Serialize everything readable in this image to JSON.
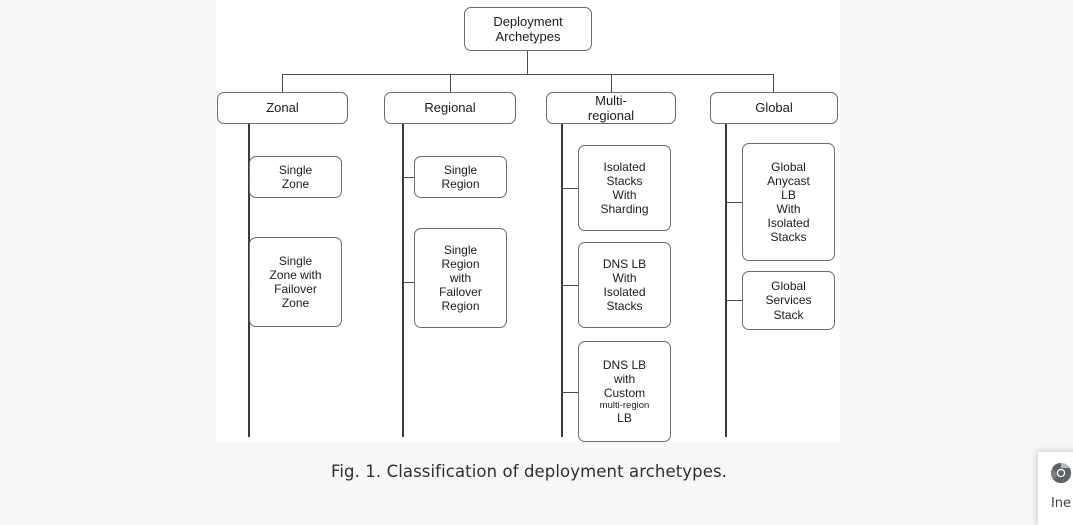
{
  "figure": {
    "root": {
      "label": "Deployment\nArchetypes"
    },
    "categories": [
      {
        "id": "zonal",
        "label": "Zonal"
      },
      {
        "id": "regional",
        "label": "Regional"
      },
      {
        "id": "multi-regional",
        "label": "Multi-\nregional"
      },
      {
        "id": "global",
        "label": "Global"
      }
    ],
    "leaves": {
      "zonal": [
        {
          "label": "Single\nZone"
        },
        {
          "label": "Single\nZone with\nFailover\nZone"
        }
      ],
      "regional": [
        {
          "label": "Single\nRegion"
        },
        {
          "label": "Single\nRegion\nwith\nFailover\nRegion"
        }
      ],
      "multi_regional": [
        {
          "label": "Isolated\nStacks\nWith\nSharding"
        },
        {
          "label": "DNS LB\nWith\nIsolated\nStacks"
        },
        {
          "label": "DNS LB\nwith\nCustom\nmulti-region\nLB",
          "small_line_index": 3
        }
      ],
      "global": [
        {
          "label": "Global\nAnycast\nLB\nWith\nIsolated\nStacks"
        },
        {
          "label": "Global\nServices\nStack"
        }
      ]
    }
  },
  "caption": {
    "text": "Fig. 1. Classification of deployment archetypes."
  },
  "taskbar": {
    "icon_name": "chrome-icon",
    "label": "Ine"
  },
  "colors": {
    "page_background": "#f7f7f7",
    "figure_background": "#ffffff",
    "node_border": "#6b6b6b",
    "connector": "#4a4a4a",
    "text": "#1b1b1b",
    "caption_text": "#2f2f2f"
  }
}
